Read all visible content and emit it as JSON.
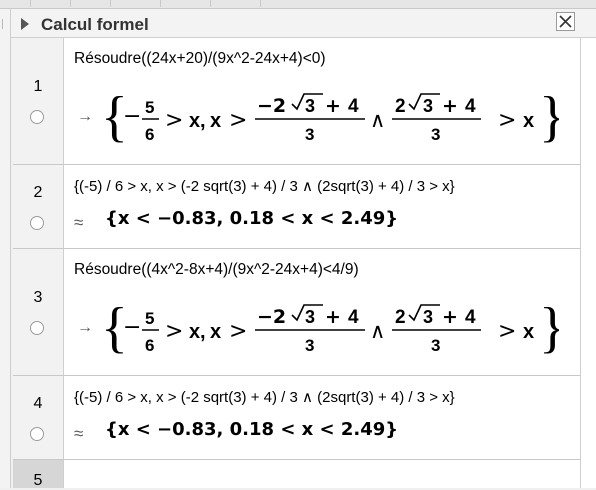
{
  "window": {
    "title": "Calcul formel",
    "close_icon": "close-icon"
  },
  "rows": [
    {
      "number": "1",
      "input": "Résoudre((24x+20)/(9x^2-24x+4)<0)",
      "output_symbol": "→",
      "output_math": {
        "open_brace": "{",
        "close_brace": "}",
        "minus": "−",
        "frac1_num": "5",
        "frac1_den": "6",
        "gt": ">",
        "x": "x",
        "comma": ",",
        "frac2_num_a": "−2",
        "sqrt_arg": "3",
        "plus": "+",
        "frac2_num_b": "4",
        "frac2_den": "3",
        "and": "∧",
        "frac3_num_a": "2",
        "frac3_num_b": "4",
        "frac3_den": "3"
      }
    },
    {
      "number": "2",
      "input": "{(-5) / 6 > x, x > (-2 sqrt(3) + 4) / 3 ∧ (2sqrt(3) + 4) / 3 > x}",
      "output_symbol": "≈",
      "output_text": "{x < −0.83, 0.18 < x < 2.49}"
    },
    {
      "number": "3",
      "input": "Résoudre((4x^2-8x+4)/(9x^2-24x+4)<4/9)",
      "output_symbol": "→",
      "output_math": {
        "open_brace": "{",
        "close_brace": "}",
        "minus": "−",
        "frac1_num": "5",
        "frac1_den": "6",
        "gt": ">",
        "x": "x",
        "comma": ",",
        "frac2_num_a": "−2",
        "sqrt_arg": "3",
        "plus": "+",
        "frac2_num_b": "4",
        "frac2_den": "3",
        "and": "∧",
        "frac3_num_a": "2",
        "frac3_num_b": "4",
        "frac3_den": "3"
      }
    },
    {
      "number": "4",
      "input": "{(-5) / 6 > x, x > (-2 sqrt(3) + 4) / 3 ∧ (2sqrt(3) + 4) / 3 > x}",
      "output_symbol": "≈",
      "output_text": "{x < −0.83, 0.18 < x < 2.49}"
    },
    {
      "number": "5"
    }
  ]
}
